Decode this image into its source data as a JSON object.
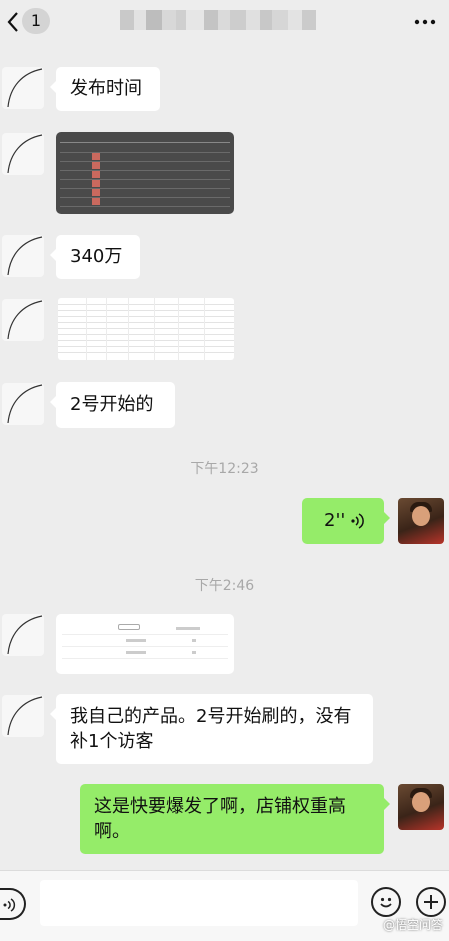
{
  "header": {
    "back_badge": "1",
    "title_icon": "blurred-title",
    "more_icon": "more-dots-icon"
  },
  "messages": [
    {
      "side": "left",
      "type": "text",
      "text": "发布时间"
    },
    {
      "side": "left",
      "type": "image",
      "image": "dark-list-screenshot"
    },
    {
      "side": "left",
      "type": "text",
      "text": "340万"
    },
    {
      "side": "left",
      "type": "image",
      "image": "table-screenshot"
    },
    {
      "side": "left",
      "type": "text",
      "text": "2号开始的"
    },
    {
      "side": "center",
      "type": "time",
      "text": "下午12:23"
    },
    {
      "side": "right",
      "type": "voice",
      "text": "2''"
    },
    {
      "side": "center",
      "type": "time",
      "text": "下午2:46"
    },
    {
      "side": "left",
      "type": "image",
      "image": "white-stats-screenshot"
    },
    {
      "side": "left",
      "type": "text",
      "text": "我自己的产品。2号开始刷的，没有补1个访客"
    },
    {
      "side": "right",
      "type": "text",
      "text": "这是快要爆发了啊，店铺权重高啊。"
    }
  ],
  "bottom": {
    "voice_icon": "voice-mode-icon",
    "emoji_icon": "emoji-icon",
    "plus_icon": "plus-icon",
    "watermark": "@悟空问答"
  },
  "colors": {
    "background": "#ededed",
    "left_bubble": "#ffffff",
    "right_bubble": "#95ec69",
    "time_text": "#a8a8a8"
  }
}
